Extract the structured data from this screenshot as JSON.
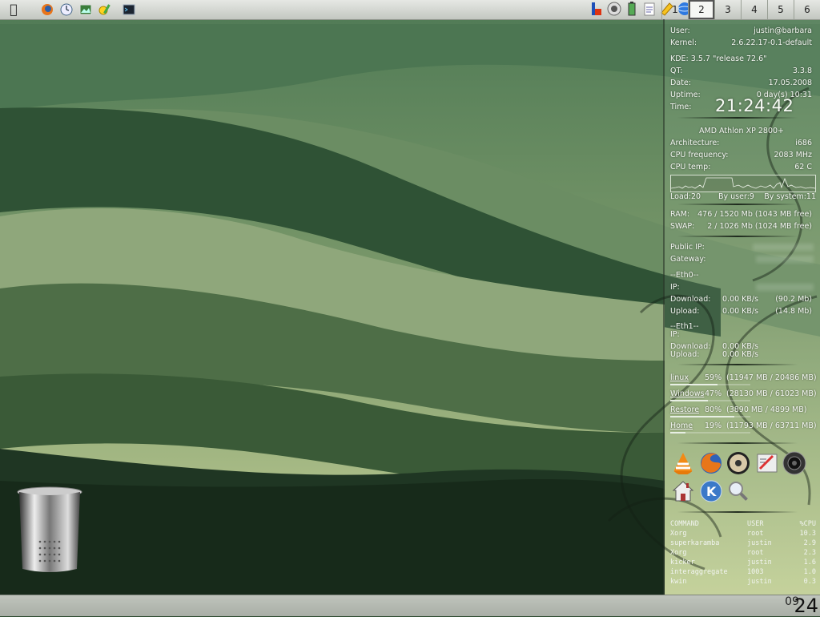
{
  "taskbar": {
    "launcher_icons": [
      "apple-menu-icon",
      "firefox-icon",
      "clock-icon",
      "image-viewer-icon",
      "control-center-icon",
      "terminal-icon"
    ],
    "tray_icons": [
      "kde-icon",
      "speaker-icon",
      "battery-icon",
      "clipboard-icon",
      "note-icon",
      "network-globe-icon"
    ],
    "desktops": [
      "1",
      "2",
      "3",
      "4",
      "5",
      "6"
    ],
    "active_desktop": "2"
  },
  "sysinfo": {
    "user_label": "User:",
    "user_value": "justin@barbara",
    "kernel_label": "Kernel:",
    "kernel_value": "2.6.22.17-0.1-default",
    "kde_line": "KDE: 3.5.7 \"release 72.6\"",
    "qt_label": "QT:",
    "qt_value": "3.3.8",
    "date_label": "Date:",
    "date_value": "17.05.2008",
    "uptime_label": "Uptime:",
    "uptime_value": "0 day(s)  10:31",
    "time_label": "Time:",
    "time_value": "21:24:42",
    "cpu_name": "AMD Athlon XP 2800+",
    "arch_label": "Architecture:",
    "arch_value": "i686",
    "freq_label": "CPU frequency:",
    "freq_value": "2083 MHz",
    "temp_label": "CPU temp:",
    "temp_value": "62 C",
    "load_total": "Load:20",
    "load_user": "By user:9",
    "load_system": "By system:11",
    "ram_label": "RAM:",
    "ram_value": "476 / 1520 Mb (1043 MB free)",
    "swap_label": "SWAP:",
    "swap_value": "2 / 1026 Mb (1024 MB free)",
    "public_ip_label": "Public IP:",
    "gateway_label": "Gateway:",
    "eth0_header": "--Eth0--",
    "eth0_ip_label": "IP:",
    "eth0_download_label": "Download:",
    "eth0_download_rate": "0.00 KB/s",
    "eth0_download_total": "(90.2 Mb)",
    "eth0_upload_label": "Upload:",
    "eth0_upload_rate": "0.00 KB/s",
    "eth0_upload_total": "(14.8 Mb)",
    "eth1_header": "--Eth1--",
    "eth1_ip_label": "IP:",
    "eth1_download_label": "Download:",
    "eth1_download_rate": "0.00 KB/s",
    "eth1_upload_label": "Upload:",
    "eth1_upload_rate": "0.00 KB/s"
  },
  "disks": [
    {
      "name": "linux",
      "pct": "59%",
      "detail": "(11947 MB / 20486 MB)",
      "fill": 0.59
    },
    {
      "name": "Windows",
      "pct": "47%",
      "detail": "(28130 MB / 61023 MB)",
      "fill": 0.47
    },
    {
      "name": "Restore",
      "pct": "80%",
      "detail": "(3890 MB / 4899 MB)",
      "fill": 0.8
    },
    {
      "name": "Home",
      "pct": "19%",
      "detail": "(11793 MB / 63711 MB)",
      "fill": 0.19
    }
  ],
  "app_icons": [
    "vlc-icon",
    "firefox-icon",
    "cd-player-icon",
    "text-editor-icon",
    "camera-lens-icon",
    "home-folder-icon",
    "kde-menu-icon",
    "search-icon"
  ],
  "processes": {
    "headers": [
      "COMMAND",
      "USER",
      "%CPU"
    ],
    "rows": [
      [
        "Xorg",
        "root",
        "10.3"
      ],
      [
        "superkaramba",
        "justin",
        "2.9"
      ],
      [
        "Xorg",
        "root",
        "2.3"
      ],
      [
        "kicker",
        "justin",
        "1.6"
      ],
      [
        "interaggregate",
        "1003",
        "1.0"
      ],
      [
        "kwin",
        "justin",
        "0.3"
      ]
    ]
  },
  "bottom_clock": {
    "hour": "09",
    "minute": "24"
  },
  "colors": {
    "sky": "#b9c9a0",
    "hills_dark": "#1f3623",
    "panel_text": "#f4f7f2"
  }
}
